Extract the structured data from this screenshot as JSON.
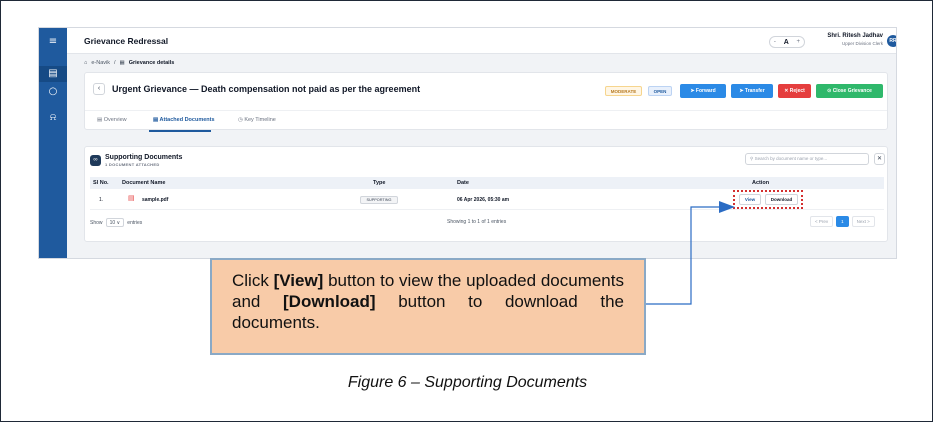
{
  "app": {
    "title": "Grievance Redressal"
  },
  "sidebar": {
    "items": [
      {
        "icon": "menu-icon",
        "glyph": "≡"
      },
      {
        "icon": "document-icon",
        "glyph": "▤"
      },
      {
        "icon": "circle-icon",
        "glyph": "○"
      },
      {
        "icon": "bell-icon",
        "glyph": "⍾"
      }
    ]
  },
  "topbar": {
    "font_minus": "-",
    "font_label": "A",
    "font_plus": "+",
    "user_name": "Shri. Ritesh Jadhav",
    "user_role": "Upper Division Clerk",
    "avatar": "RR"
  },
  "breadcrumb": {
    "home": "e-Navik",
    "sep": "/",
    "current": "Grievance details"
  },
  "grievance": {
    "title": "Urgent Grievance — Death compensation not paid as per the agreement",
    "badge_priority": "MODERATE",
    "badge_status": "OPEN",
    "buttons": {
      "forward": "➤  Forward",
      "transfer": "➤  Transfer",
      "reject": "✕ Reject",
      "close": "⊙  Close Grievance"
    }
  },
  "tabs": [
    {
      "label": "▤  Overview"
    },
    {
      "label": "▤  Attached Documents"
    },
    {
      "label": "◷  Key Timeline"
    }
  ],
  "documents": {
    "heading": "Supporting Documents",
    "subheading": "1 DOCUMENT ATTACHED",
    "search_placeholder": "Search by document name or type...",
    "clear": "✕",
    "columns": {
      "sl": "Sl No.",
      "name": "Document Name",
      "type": "Type",
      "date": "Date",
      "action": "Action"
    },
    "rows": [
      {
        "sl": "1.",
        "name": "sample.pdf",
        "type": "SUPPORTING",
        "date": "06 Apr 2026, 05:30 am",
        "view": "View",
        "download": "Download"
      }
    ],
    "show_label": "Show",
    "entries_value": "10 ∨",
    "entries_label": "entries",
    "info": "Showing 1 to 1 of 1 entries",
    "pager": {
      "prev": "< Prev",
      "page": "1",
      "next": "Next >"
    }
  },
  "callout": {
    "p1": "Click ",
    "view": "[View]",
    "p2": " button to view the uploaded documents and ",
    "download": "[Download]",
    "p3": " button to download the documents."
  },
  "caption": "Figure 6 – Supporting Documents"
}
